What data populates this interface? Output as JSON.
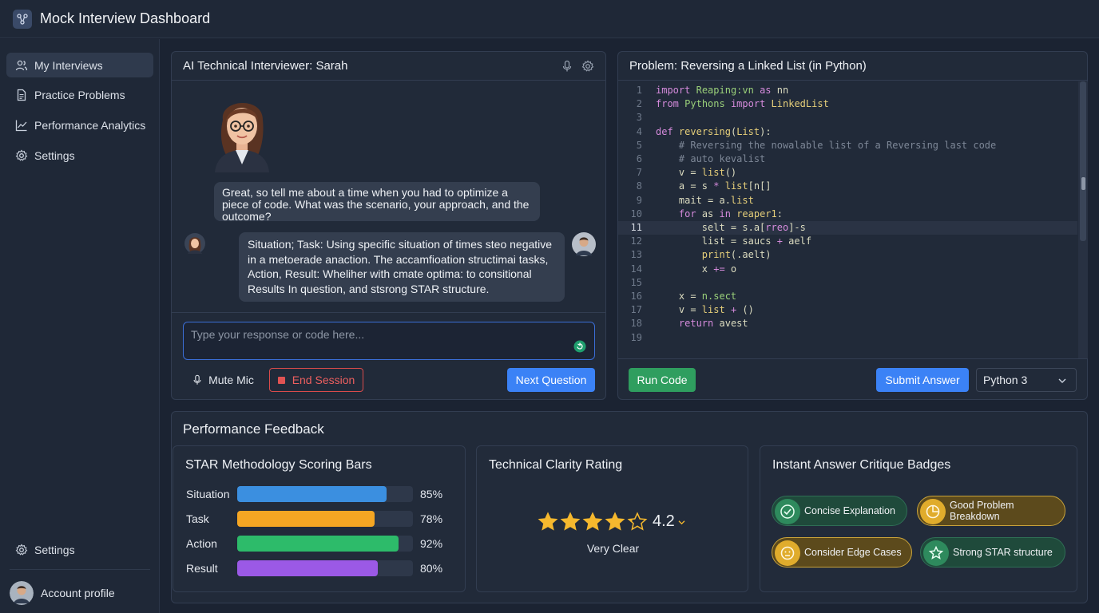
{
  "app": {
    "title": "Mock Interview Dashboard"
  },
  "sidebar": {
    "items": [
      {
        "label": "My Interviews",
        "icon": "users-icon",
        "active": true
      },
      {
        "label": "Practice Problems",
        "icon": "document-icon"
      },
      {
        "label": "Performance Analytics",
        "icon": "chart-icon"
      },
      {
        "label": "Settings",
        "icon": "gear-icon"
      }
    ],
    "bottom_settings": "Settings",
    "account": "Account profile"
  },
  "interviewer": {
    "title": "AI Technical Interviewer: Sarah",
    "question": "Great, so tell me about a time when you had to optimize a piece of code. What was the scenario, your approach, and the outcome?",
    "answer": "Situation; Task: Using  specific situation of times steo negative in a metoerade anaction. The accamfioation structimai tasks, Action, Result: Wheliher with cmate optima: to consitional Results In question, and stsrong STAR structure.",
    "input_placeholder": "Type your response or code here...",
    "mute_label": "Mute Mic",
    "end_label": "End Session",
    "next_label": "Next Question"
  },
  "problem": {
    "title": "Problem: Reversing a Linked List (in Python)",
    "lines": [
      {
        "n": "1",
        "html": "<span class=\"kw\">import</span> <span class=\"str\">Reaping:vn</span> <span class=\"kw\">as</span> nn"
      },
      {
        "n": "2",
        "html": "<span class=\"kw\">from</span> <span class=\"str\">Pythons</span> <span class=\"kw\">import</span> <span class=\"fn\">LinkedList</span>"
      },
      {
        "n": "3",
        "html": ""
      },
      {
        "n": "4",
        "html": "<span class=\"kw\">def</span> <span class=\"fn\">reversing</span>(<span class=\"fn\">List</span>):"
      },
      {
        "n": "5",
        "html": "    <span class=\"cm\"># Reversing the nowalable list of a Reversing last code</span>"
      },
      {
        "n": "6",
        "html": "    <span class=\"cm\"># auto kevalist</span>"
      },
      {
        "n": "7",
        "html": "    v = <span class=\"fn\">list</span>()"
      },
      {
        "n": "8",
        "html": "    a = s <span class=\"kw\">*</span> <span class=\"fn\">list</span>[n[]"
      },
      {
        "n": "9",
        "html": "    mait = a.<span class=\"fn\">list</span>"
      },
      {
        "n": "10",
        "html": "    <span class=\"kw\">for</span> as <span class=\"kw\">in</span> <span class=\"fn\">reaper1</span>:"
      },
      {
        "n": "11",
        "html": "        selt = s.a[<span class=\"kw\">rreo</span>]-s",
        "hl": true
      },
      {
        "n": "12",
        "html": "        list = saucs <span class=\"kw\">+</span> aelf"
      },
      {
        "n": "13",
        "html": "        <span class=\"fn\">print</span>(.aelt)"
      },
      {
        "n": "14",
        "html": "        x <span class=\"kw\">+=</span> o"
      },
      {
        "n": "15",
        "html": ""
      },
      {
        "n": "16",
        "html": "    x = <span class=\"str\">n.sect</span>"
      },
      {
        "n": "17",
        "html": "    v = <span class=\"fn\">list</span> <span class=\"kw\">+</span> ()"
      },
      {
        "n": "18",
        "html": "    <span class=\"kw\">return</span> avest"
      },
      {
        "n": "19",
        "html": ""
      }
    ],
    "run_label": "Run Code",
    "submit_label": "Submit Answer",
    "language": "Python 3"
  },
  "feedback": {
    "title": "Performance Feedback",
    "star": {
      "title": "STAR Methodology Scoring Bars",
      "bars": [
        {
          "label": "Situation",
          "value": 85,
          "pct": "85%",
          "color": "#3b8fe0"
        },
        {
          "label": "Task",
          "value": 78,
          "pct": "78%",
          "color": "#f5a623"
        },
        {
          "label": "Action",
          "value": 92,
          "pct": "92%",
          "color": "#2dbb6a"
        },
        {
          "label": "Result",
          "value": 80,
          "pct": "80%",
          "color": "#9b59e6"
        }
      ]
    },
    "clarity": {
      "title": "Technical Clarity Rating",
      "rating": 4.2,
      "rating_text": "4.2",
      "caption": "Very Clear"
    },
    "critique": {
      "title": "Instant Answer Critique Badges",
      "badges": [
        {
          "label": "Concise Explanation",
          "icon": "check-icon",
          "tone": "green"
        },
        {
          "label": "Good Problem Breakdown",
          "icon": "pie-chart-icon",
          "tone": "gold"
        },
        {
          "label": "Consider Edge Cases",
          "icon": "face-icon",
          "tone": "gold"
        },
        {
          "label": "Strong STAR structure",
          "icon": "star-icon",
          "tone": "green"
        }
      ]
    }
  }
}
